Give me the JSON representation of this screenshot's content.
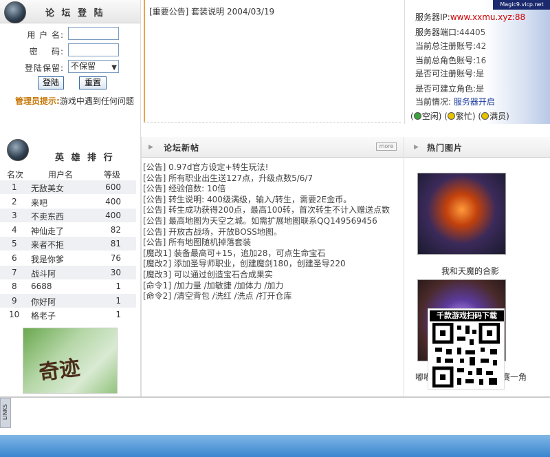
{
  "login": {
    "title": "论 坛 登 陆",
    "username_label": "用 户 名:",
    "password_label": "密    码:",
    "remember_label": "登陆保留:",
    "remember_value": "不保留",
    "login_button": "登陆",
    "reset_button": "重置",
    "notice_label": "管理员提示:",
    "notice_text": "游戏中遇到任何问题"
  },
  "ranking": {
    "title": "英 雄 排 行",
    "col_rank": "名次",
    "col_name": "用户名",
    "col_level": "等级",
    "rows": [
      {
        "rank": "1",
        "name": "无敌美女",
        "level": "600"
      },
      {
        "rank": "2",
        "name": "来吧",
        "level": "400"
      },
      {
        "rank": "3",
        "name": "不卖东西",
        "level": "400"
      },
      {
        "rank": "4",
        "name": "神仙走了",
        "level": "82"
      },
      {
        "rank": "5",
        "name": "来者不拒",
        "level": "81"
      },
      {
        "rank": "6",
        "name": "我是你爹",
        "level": "76"
      },
      {
        "rank": "7",
        "name": "战斗阿",
        "level": "30"
      },
      {
        "rank": "8",
        "name": "6688",
        "level": "1"
      },
      {
        "rank": "9",
        "name": "你好阿",
        "level": "1"
      },
      {
        "rank": "10",
        "name": "格老子",
        "level": "1"
      }
    ],
    "logo_text": "奇迹"
  },
  "announcement": {
    "text": "[重要公告] 套装说明 2004/03/19"
  },
  "server": {
    "ip_label": "服务器IP:",
    "ip_value": "www.xxmu.xyz:88",
    "port_label": "服务器端口:",
    "port_value": "44405",
    "total_accounts_label": "当前总注册账号:",
    "total_accounts_value": "42",
    "total_chars_label": "当前总角色账号:",
    "total_chars_value": "16",
    "can_register_label": "是否可注册账号:",
    "can_register_value": "是",
    "can_create_label": "是否可建立角色:",
    "can_create_value": "是",
    "status_label": "当前情况:",
    "status_value": "服务器开启",
    "legend_idle": "空闲",
    "legend_busy": "繁忙",
    "legend_full": "满员",
    "mini_logo": "Magic9.vicp.net",
    "colors": {
      "idle": "#3aa33a",
      "busy": "#e8c400",
      "full": "#e8c400"
    }
  },
  "news": {
    "title": "论坛新帖",
    "more": "more",
    "items": [
      "[公告] 0.97d官方设定+转生玩法!",
      "[公告] 所有职业出生送127点，升级点数5/6/7",
      "[公告] 经验倍数: 10倍",
      "[公告] 转生说明: 400级满级，输入/转生，需要2E金币。",
      "[公告] 转生成功获得200点，最高100转，首次转生不计入赠送点数",
      "[公告] 最高地图为天空之城。如需扩展地图联系QQ149569456",
      "[公告] 开放古战场，开放BOSS地图。",
      "[公告] 所有地图随机掉落套装",
      "[魔改1] 装备最高可+15，追加28，可点生命宝石",
      "[魔改2] 添加圣导师职业，创建魔剑180，创建圣导220",
      "[魔改3] 可以通过创造宝石合成果实",
      "[命令1] /加力量 /加敏捷 /加体力 /加力",
      "[命令2] /清空背包 /洗红 /洗点 /打开仓库"
    ]
  },
  "hot": {
    "title": "热门图片",
    "caption1": "我和天魔的合影",
    "caption2_left": "嘟嘟",
    "caption2_right": "赛一角",
    "qr_title": "千款游戏扫码下载"
  },
  "links": {
    "label": "LINKS"
  }
}
